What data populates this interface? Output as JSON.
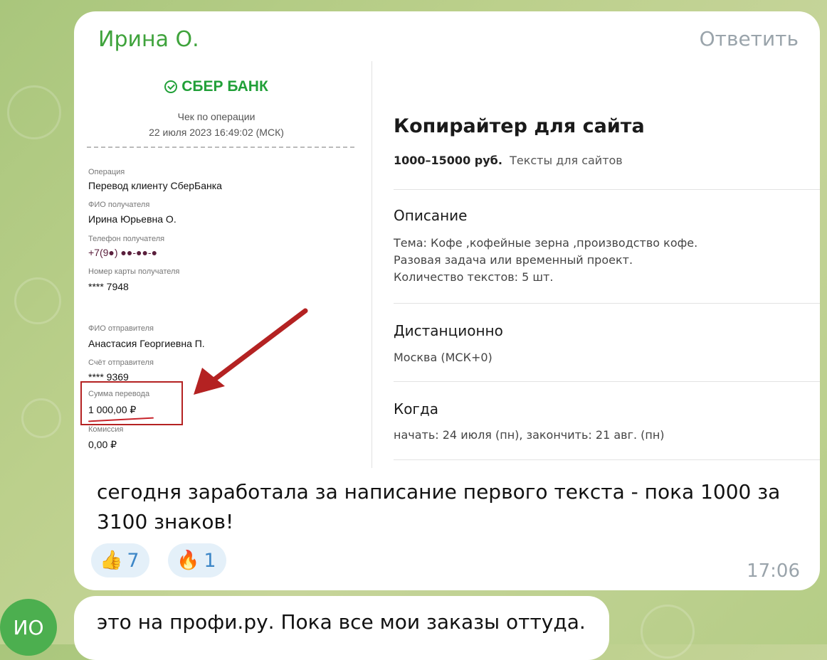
{
  "message": {
    "sender": "Ирина О.",
    "reply_label": "Ответить",
    "text": "сегодня заработала за написание первого текста - пока 1000 за 3100 знаков!",
    "time": "17:06",
    "reactions": [
      {
        "emoji": "👍",
        "count": "7"
      },
      {
        "emoji": "🔥",
        "count": "1"
      }
    ]
  },
  "receipt": {
    "bank": "СБЕР БАНК",
    "title": "Чек по операции",
    "datetime": "22 июля 2023 16:49:02 (МСК)",
    "fields": [
      {
        "label": "Операция",
        "value": "Перевод клиенту СберБанка"
      },
      {
        "label": "ФИО получателя",
        "value": "Ирина Юрьевна О."
      },
      {
        "label": "Телефон получателя",
        "value": "+7(9●) ●●-●●-●"
      },
      {
        "label": "Номер карты получателя",
        "value": "**** 7948"
      },
      {
        "label": "ФИО отправителя",
        "value": "Анастасия Георгиевна П."
      },
      {
        "label": "Счёт отправителя",
        "value": "**** 9369"
      },
      {
        "label": "Сумма перевода",
        "value": "1 000,00 ₽"
      },
      {
        "label": "Комиссия",
        "value": "0,00 ₽"
      }
    ]
  },
  "job": {
    "title": "Копирайтер для сайта",
    "price": "1000–15000 руб.",
    "category": "Тексты для сайтов",
    "description_heading": "Описание",
    "description_lines": [
      "Тема: Кофе ,кофейные зерна ,производство кофе.",
      "Разовая задача или временный проект.",
      "Количество текстов: 5 шт."
    ],
    "location_heading": "Дистанционно",
    "location": "Москва (МСК+0)",
    "when_heading": "Когда",
    "when": "начать: 24 июля (пн), закончить: 21 авг. (пн)"
  },
  "message2": {
    "text": "это на профи.ру. Пока все мои заказы оттуда.",
    "avatar_initials": "ИО"
  },
  "colors": {
    "sender": "#3fa33c",
    "sber_green": "#21a038",
    "highlight_red": "#b42222",
    "reaction_bg": "#e4f0f9",
    "reaction_count": "#3c86c7",
    "avatar": "#4caf4f"
  }
}
